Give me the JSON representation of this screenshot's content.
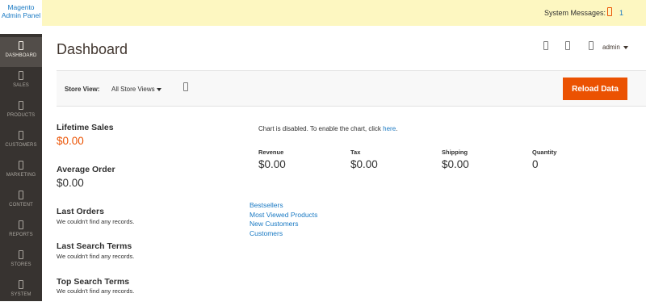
{
  "sidebar": {
    "logo_line1": "Magento",
    "logo_line2": "Admin Panel",
    "items": [
      {
        "label": "DASHBOARD",
        "icon": "dashboard-icon",
        "active": true
      },
      {
        "label": "SALES",
        "icon": "sales-icon"
      },
      {
        "label": "PRODUCTS",
        "icon": "products-icon"
      },
      {
        "label": "CUSTOMERS",
        "icon": "customers-icon"
      },
      {
        "label": "MARKETING",
        "icon": "marketing-icon"
      },
      {
        "label": "CONTENT",
        "icon": "content-icon"
      },
      {
        "label": "REPORTS",
        "icon": "reports-icon"
      },
      {
        "label": "STORES",
        "icon": "stores-icon"
      },
      {
        "label": "SYSTEM",
        "icon": "system-icon"
      }
    ]
  },
  "system_messages": {
    "label": "System Messages:",
    "count": "1"
  },
  "header": {
    "title": "Dashboard",
    "user": "admin"
  },
  "store_switcher": {
    "label": "Store View:",
    "value": "All Store Views"
  },
  "reload_button": "Reload Data",
  "stats": {
    "lifetime_sales": {
      "title": "Lifetime Sales",
      "value": "$0.00"
    },
    "average_order": {
      "title": "Average Order",
      "value": "$0.00"
    }
  },
  "grids": {
    "last_orders": {
      "title": "Last Orders",
      "empty": "We couldn't find any records."
    },
    "last_search_terms": {
      "title": "Last Search Terms",
      "empty": "We couldn't find any records."
    },
    "top_search_terms": {
      "title": "Top Search Terms",
      "empty": "We couldn't find any records."
    }
  },
  "chart_notice": {
    "text": "Chart is disabled. To enable the chart, click ",
    "link": "here",
    "suffix": "."
  },
  "totals": [
    {
      "label": "Revenue",
      "value": "$0.00"
    },
    {
      "label": "Tax",
      "value": "$0.00"
    },
    {
      "label": "Shipping",
      "value": "$0.00"
    },
    {
      "label": "Quantity",
      "value": "0"
    }
  ],
  "tabs": [
    "Bestsellers",
    "Most Viewed Products",
    "New Customers",
    "Customers"
  ],
  "colors": {
    "accent": "#eb5202",
    "link": "#1979c3",
    "sidebar": "#373330",
    "notice": "#fdf7c1"
  }
}
